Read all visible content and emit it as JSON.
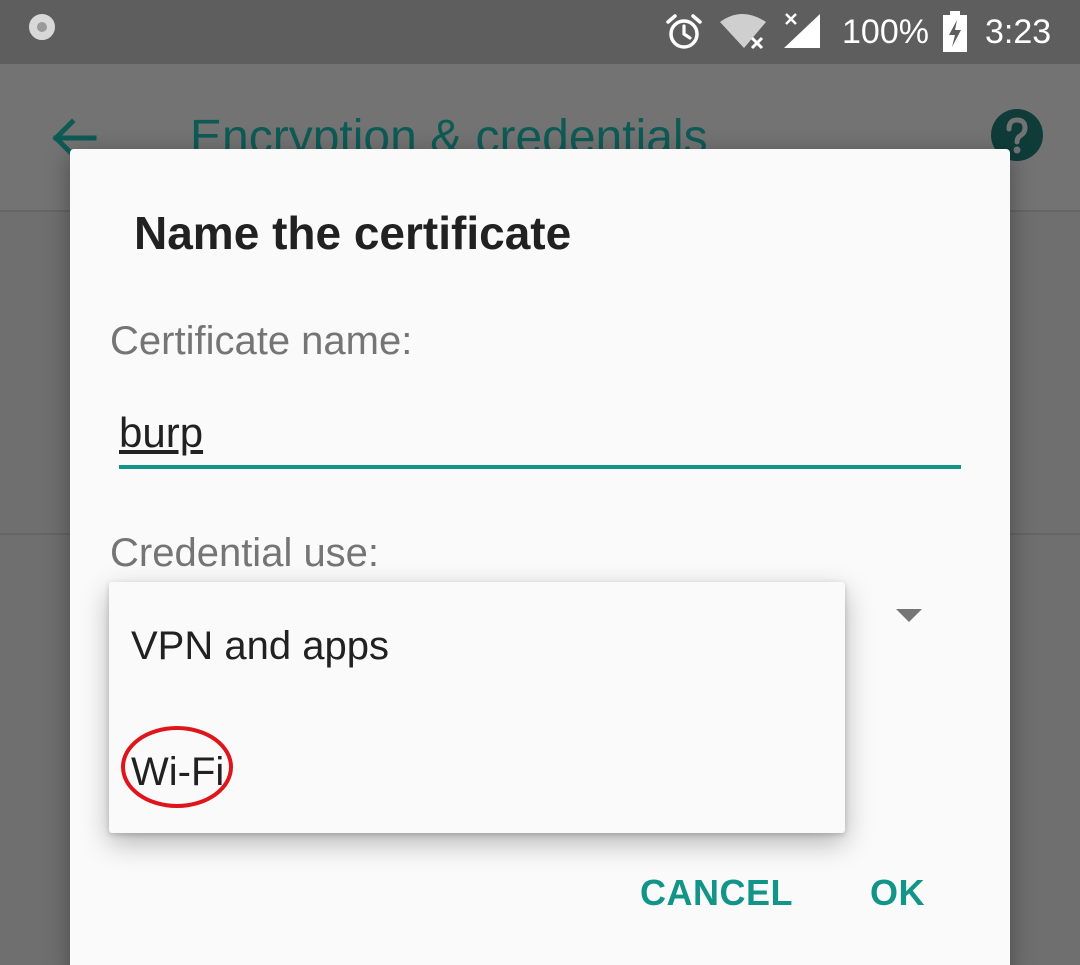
{
  "status_bar": {
    "battery_percent": "100%",
    "time": "3:23",
    "icons": [
      "notification-dot-icon",
      "alarm-icon",
      "wifi-off-icon",
      "signal-no-service-icon",
      "battery-charging-icon"
    ]
  },
  "app_bar": {
    "title": "Encryption & credentials",
    "back_icon": "arrow-back-icon",
    "help_icon": "help-icon"
  },
  "dialog": {
    "title": "Name the certificate",
    "certificate_name_label": "Certificate name:",
    "certificate_name_value": "burp",
    "credential_use_label": "Credential use:",
    "cancel_label": "CANCEL",
    "ok_label": "OK"
  },
  "dropdown": {
    "options": [
      {
        "label": "VPN and apps"
      },
      {
        "label": "Wi-Fi",
        "annotated": true
      }
    ]
  },
  "colors": {
    "accent": "#139488",
    "annotation": "#e0141b",
    "scrim_appbar_title": "#0e5a55"
  }
}
